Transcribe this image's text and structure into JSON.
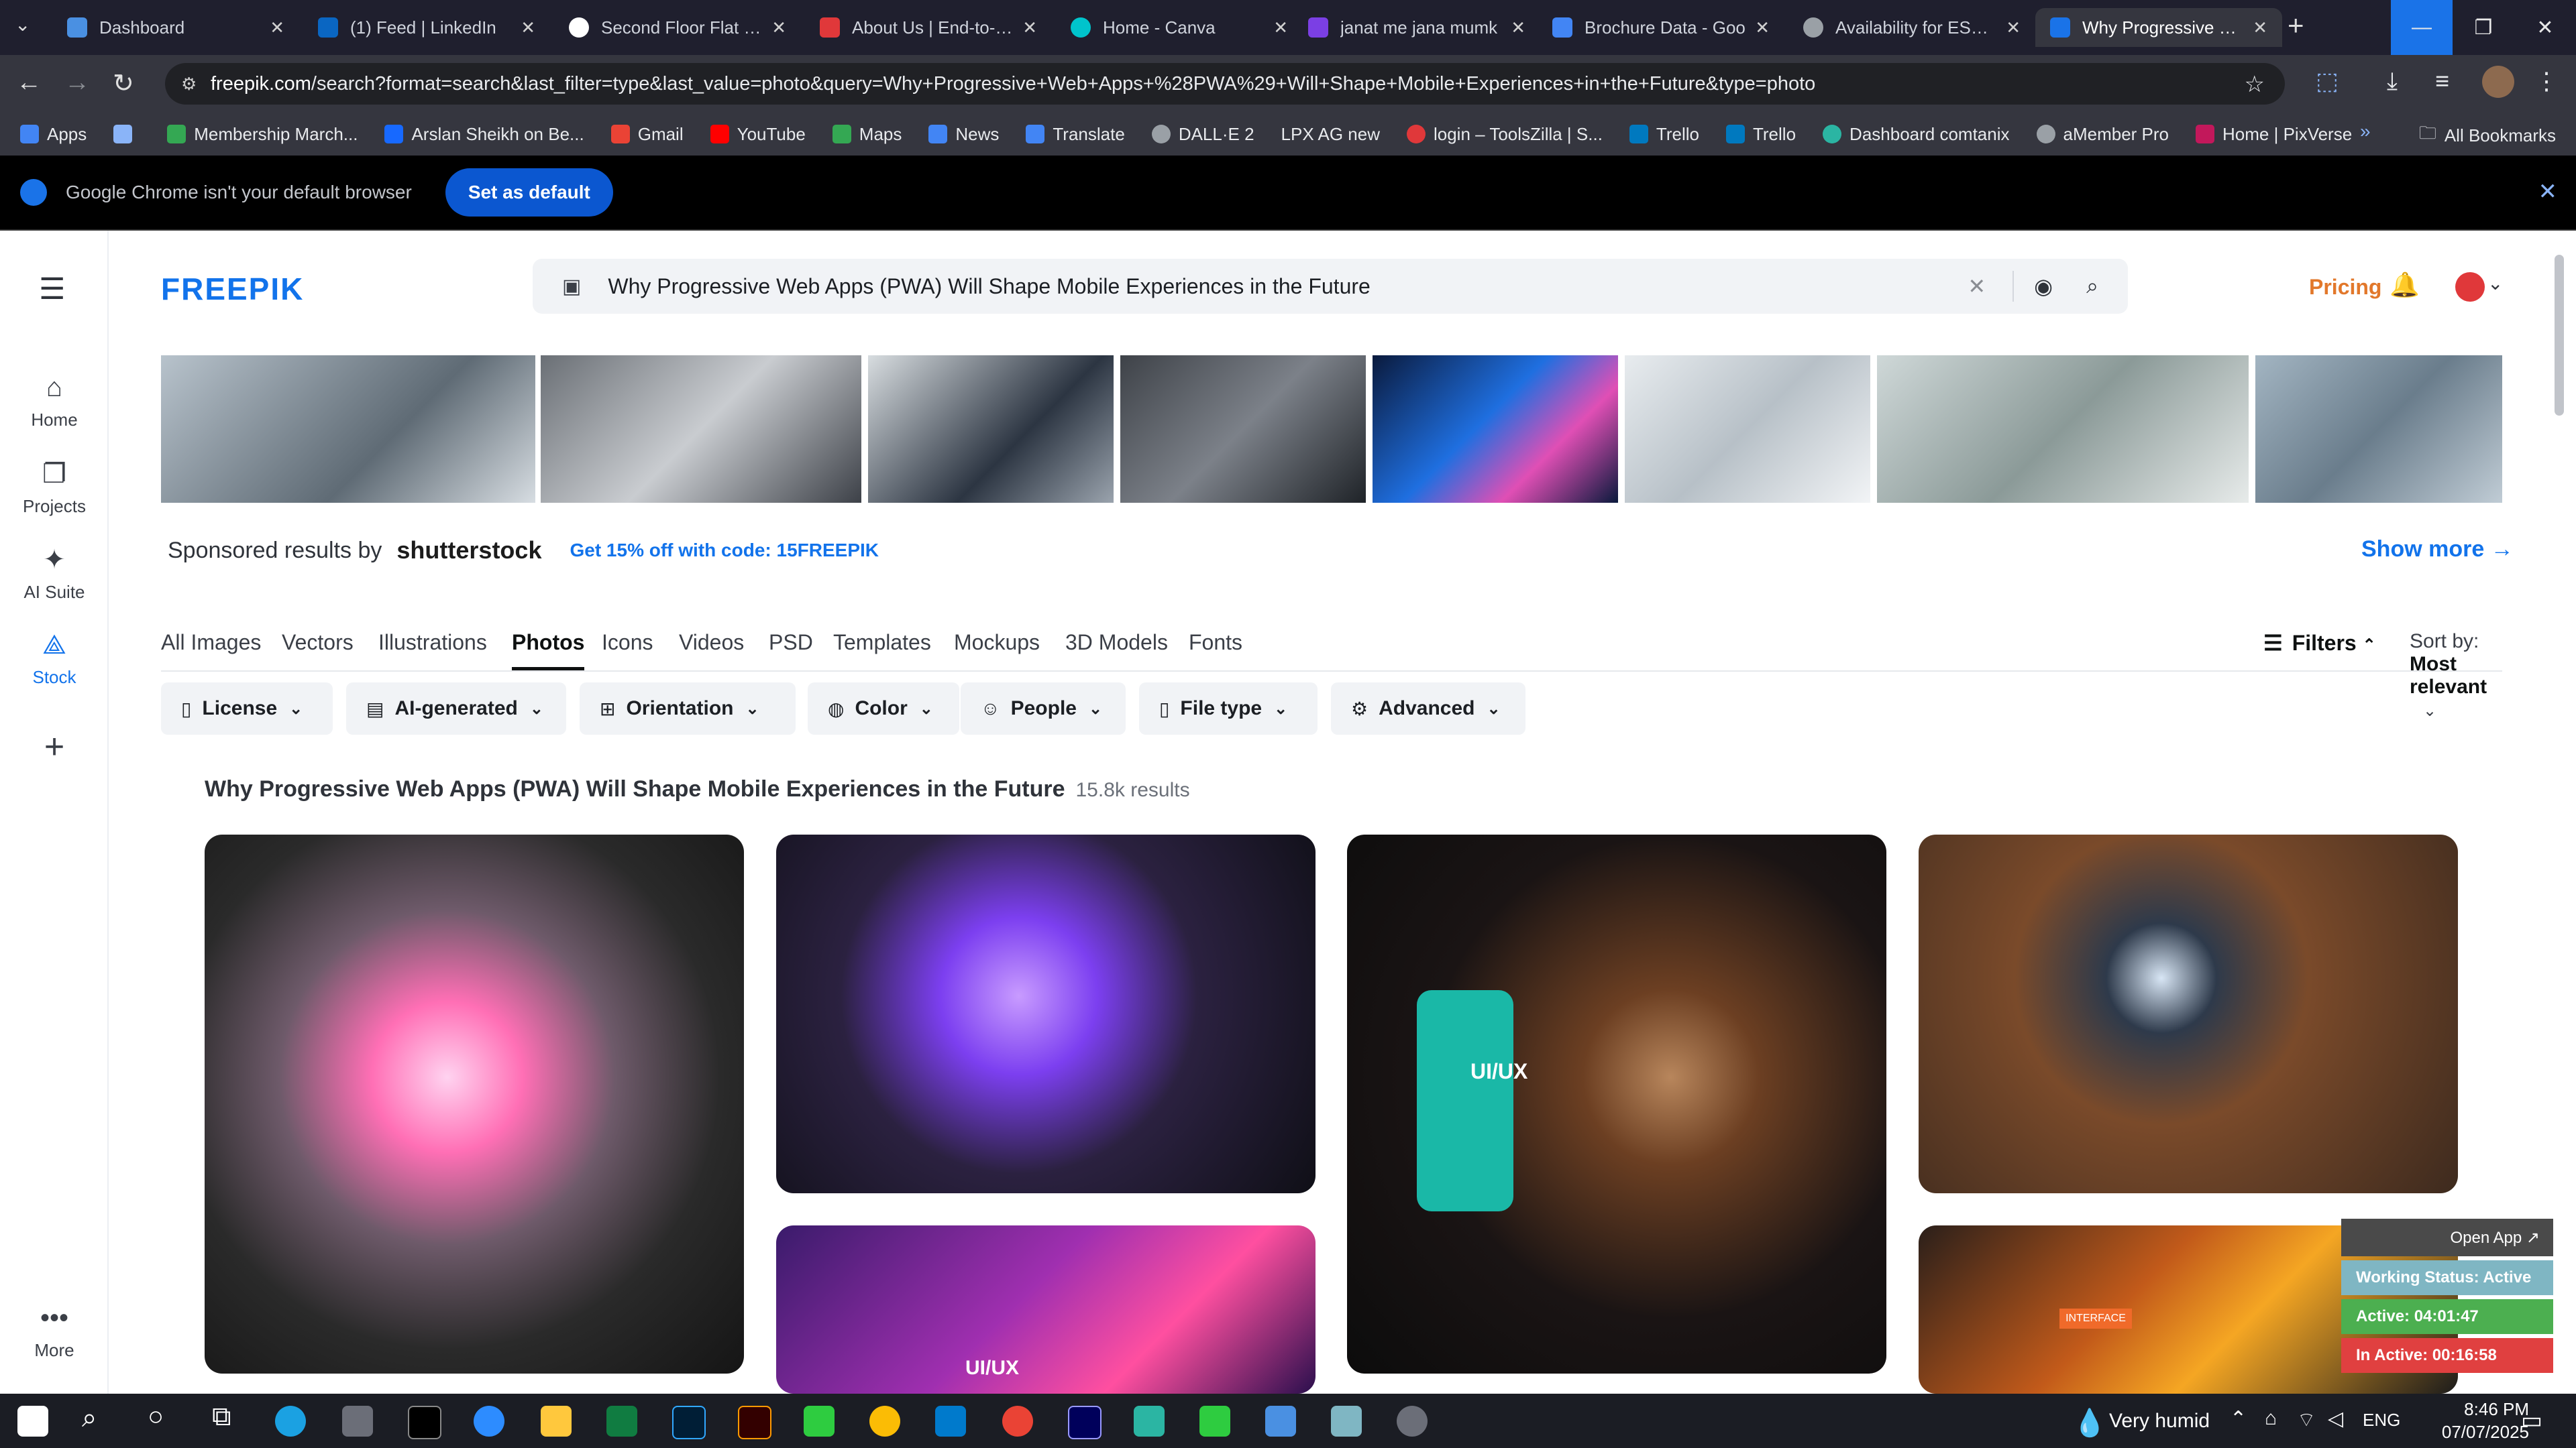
{
  "browser": {
    "tabs": [
      {
        "title": "Dashboard",
        "favicon_color": "#4a90e2",
        "active": false
      },
      {
        "title": "(1) Feed | LinkedIn",
        "favicon_color": "#0a66c2",
        "active": false
      },
      {
        "title": "Second Floor Flat For",
        "favicon_color": "#ffffff",
        "active": false
      },
      {
        "title": "About Us | End-to-En",
        "favicon_color": "#e0383a",
        "active": false
      },
      {
        "title": "Home - Canva",
        "favicon_color": "#00c4cc",
        "active": false
      },
      {
        "title": "janat me jana mumk",
        "favicon_color": "#7b3fe4",
        "active": false
      },
      {
        "title": "Brochure Data - Goo",
        "favicon_color": "#4285f4",
        "active": false
      },
      {
        "title": "Availability for EST sh",
        "favicon_color": "#9aa0a6",
        "active": false
      },
      {
        "title": "Why Progressive We",
        "favicon_color": "#1a73e8",
        "active": true
      }
    ],
    "url_domain": "freepik.com",
    "url_path": "/search?format=search&last_filter=type&last_value=photo&query=Why+Progressive+Web+Apps+%28PWA%29+Will+Shape+Mobile+Experiences+in+the+Future&type=photo",
    "bookmarks": [
      {
        "label": "Apps",
        "icon_color": "#4285f4"
      },
      {
        "label": "",
        "icon_color": "#8ab4f8"
      },
      {
        "label": "Membership March...",
        "icon_color": "#34a853"
      },
      {
        "label": "Arslan Sheikh on Be...",
        "icon_color": "#1769ff"
      },
      {
        "label": "Gmail",
        "icon_color": "#ea4335"
      },
      {
        "label": "YouTube",
        "icon_color": "#ff0000"
      },
      {
        "label": "Maps",
        "icon_color": "#34a853"
      },
      {
        "label": "News",
        "icon_color": "#4285f4"
      },
      {
        "label": "Translate",
        "icon_color": "#4285f4"
      },
      {
        "label": "DALL·E 2",
        "icon_color": "#9aa0a6"
      },
      {
        "label": "LPX AG new",
        "icon_color": "#35363f"
      },
      {
        "label": "login – ToolsZilla | S...",
        "icon_color": "#e0383a"
      },
      {
        "label": "Trello",
        "icon_color": "#0079bf"
      },
      {
        "label": "Trello",
        "icon_color": "#0079bf"
      },
      {
        "label": "Dashboard comtanix",
        "icon_color": "#2bb5a3"
      },
      {
        "label": "aMember Pro",
        "icon_color": "#9aa0a6"
      },
      {
        "label": "Home | PixVerse",
        "icon_color": "#c2185b"
      }
    ],
    "all_bookmarks": "All Bookmarks",
    "infobar_text": "Google Chrome isn't your default browser",
    "infobar_button": "Set as default"
  },
  "freepik": {
    "logo": "FREEPIK",
    "search_query": "Why Progressive Web Apps (PWA) Will Shape Mobile Experiences in the Future",
    "pricing": "Pricing",
    "leftnav": [
      {
        "label": "Home",
        "icon": "home-icon"
      },
      {
        "label": "Projects",
        "icon": "folder-icon"
      },
      {
        "label": "AI Suite",
        "icon": "sparkle-icon"
      },
      {
        "label": "Stock",
        "icon": "stock-icon"
      },
      {
        "label": "",
        "icon": "plus-icon"
      },
      {
        "label": "More",
        "icon": "more-icon"
      }
    ],
    "sponsored_text": "Sponsored results by",
    "sponsor_logo": "shutterstock",
    "promo": "Get 15% off with code: 15FREEPIK",
    "show_more": "Show more →",
    "tabs": [
      "All Images",
      "Vectors",
      "Illustrations",
      "Photos",
      "Icons",
      "Videos",
      "PSD",
      "Templates",
      "Mockups",
      "3D Models",
      "Fonts"
    ],
    "active_tab": "Photos",
    "filters_label": "Filters",
    "sort_label": "Sort by:",
    "sort_value": "Most relevant",
    "chips": [
      "License",
      "AI-generated",
      "Orientation",
      "Color",
      "People",
      "File type",
      "Advanced"
    ],
    "results_title": "Why Progressive Web Apps (PWA) Will Shape Mobile Experiences in the Future",
    "results_count": "15.8k results",
    "card_labels": {
      "uiux": "UI/UX",
      "interface": "INTERFACE"
    }
  },
  "widget": {
    "open_app": "Open App ↗",
    "working_status": "Working Status: Active",
    "active": "Active: 04:01:47",
    "inactive": "In Active: 00:16:58"
  },
  "taskbar": {
    "weather": "Very humid",
    "lang": "ENG",
    "time": "8:46 PM",
    "date": "07/07/2025"
  }
}
